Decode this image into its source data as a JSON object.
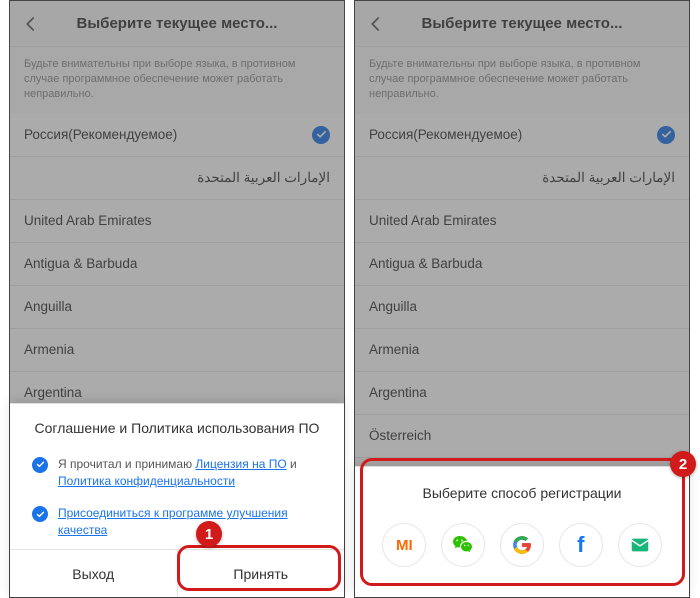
{
  "header": {
    "title": "Выберите текущее место..."
  },
  "notice": "Будьте внимательны при выборе языка, в противном случае программное обеспечение может работать неправильно.",
  "countries": [
    {
      "label": "Россия(Рекомендуемое)",
      "selected": true
    },
    {
      "label": "الإمارات العربية المتحدة",
      "rtl": true
    },
    {
      "label": "United Arab Emirates"
    },
    {
      "label": "Antigua & Barbuda"
    },
    {
      "label": "Anguilla"
    },
    {
      "label": "Armenia"
    },
    {
      "label": "Argentina"
    },
    {
      "label": "Österreich"
    }
  ],
  "agreement": {
    "title": "Соглашение и Политика использования ПО",
    "line1_prefix": "Я прочитал и принимаю ",
    "line1_link1": "Лицензия на ПО",
    "line1_mid": " и ",
    "line1_link2": "Политика конфиденциальности",
    "line2_link": "Присоединиться к программе улучшения качества",
    "exit": "Выход",
    "accept": "Принять"
  },
  "registration": {
    "title": "Выберите способ регистрации",
    "methods": [
      "mi",
      "wechat",
      "google",
      "facebook",
      "email"
    ]
  },
  "badges": {
    "one": "1",
    "two": "2"
  }
}
